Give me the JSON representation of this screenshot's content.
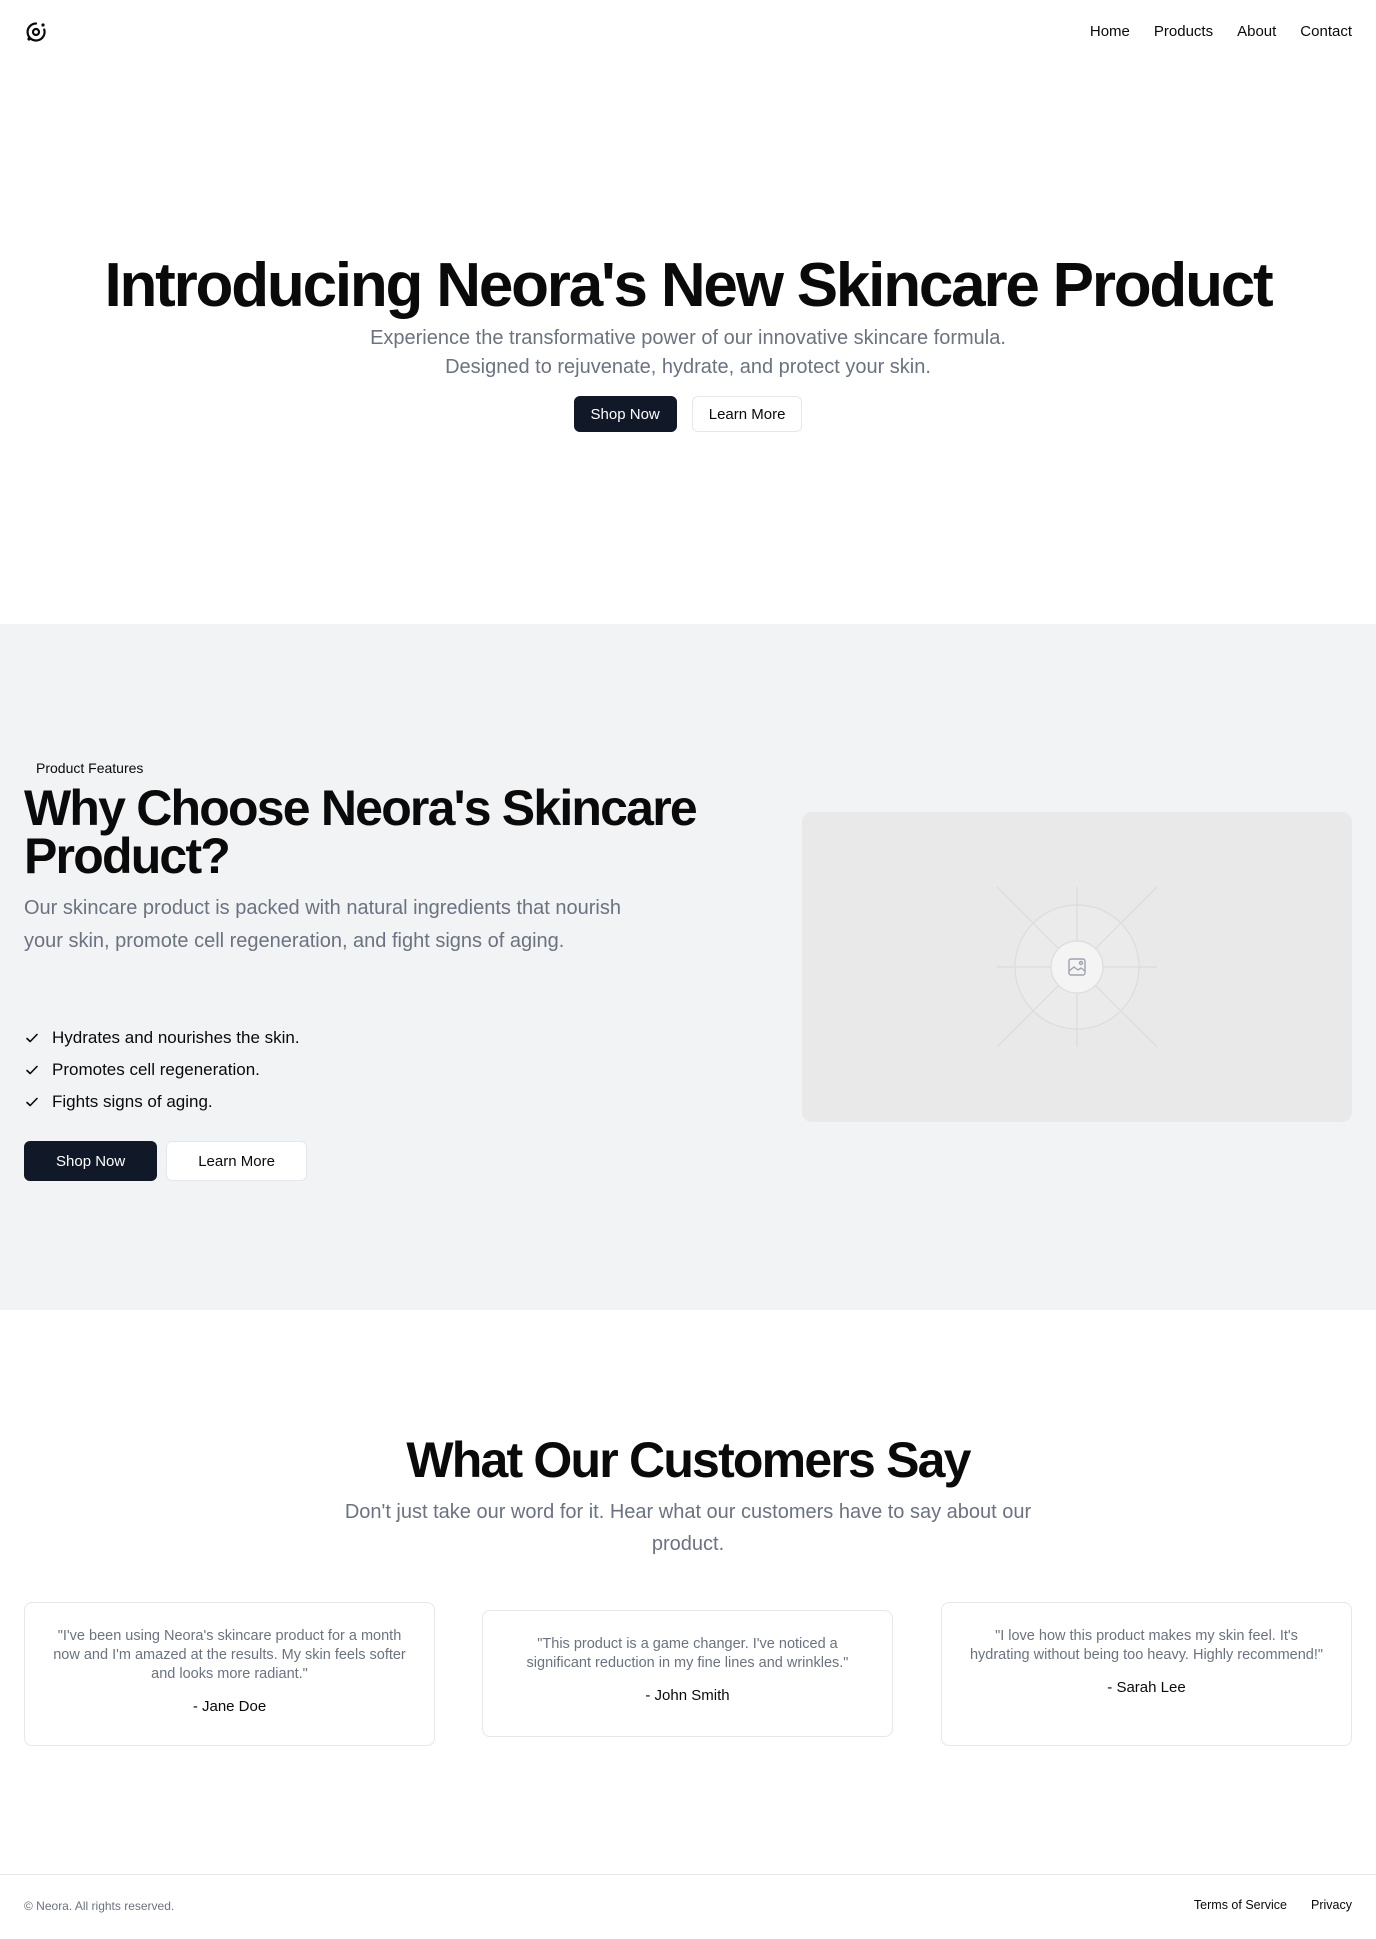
{
  "header": {
    "logo_icon": "orbit-logo-icon",
    "nav": [
      {
        "label": "Home"
      },
      {
        "label": "Products"
      },
      {
        "label": "About"
      },
      {
        "label": "Contact"
      }
    ]
  },
  "hero": {
    "title": "Introducing Neora's New Skincare Product",
    "subtitle": "Experience the transformative power of our innovative skincare formula. Designed to rejuvenate, hydrate, and protect your skin.",
    "primary_button": "Shop Now",
    "secondary_button": "Learn More"
  },
  "features": {
    "tag": "Product Features",
    "title": "Why Choose Neora's Skincare Product?",
    "description": "Our skincare product is packed with natural ingredients that nourish your skin, promote cell regeneration, and fight signs of aging.",
    "items": [
      {
        "label": "Hydrates and nourishes the skin."
      },
      {
        "label": "Promotes cell regeneration."
      },
      {
        "label": "Fights signs of aging."
      }
    ],
    "primary_button": "Shop Now",
    "secondary_button": "Learn More",
    "image_icon": "image-placeholder-icon"
  },
  "testimonials": {
    "title": "What Our Customers Say",
    "subtitle": "Don't just take our word for it. Hear what our customers have to say about our product.",
    "cards": [
      {
        "quote": "\"I've been using Neora's skincare product for a month now and I'm amazed at the results. My skin feels softer and looks more radiant.\"",
        "author": "- Jane Doe"
      },
      {
        "quote": "\"This product is a game changer. I've noticed a significant reduction in my fine lines and wrinkles.\"",
        "author": "- John Smith"
      },
      {
        "quote": "\"I love how this product makes my skin feel. It's hydrating without being too heavy. Highly recommend!\"",
        "author": "- Sarah Lee"
      }
    ]
  },
  "footer": {
    "copyright": "© Neora. All rights reserved.",
    "links": [
      {
        "label": "Terms of Service"
      },
      {
        "label": "Privacy"
      }
    ]
  },
  "colors": {
    "primary_button": "#111827",
    "muted_text": "#6b7280",
    "section_bg": "#f2f3f5"
  }
}
